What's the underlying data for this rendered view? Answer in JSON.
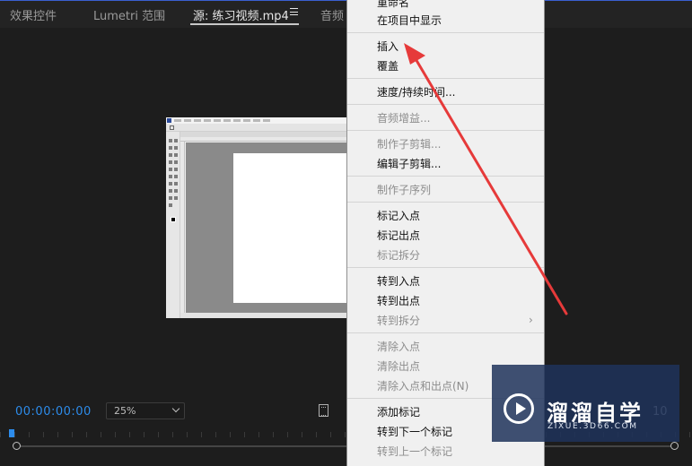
{
  "tabs": [
    {
      "label": "效果控件"
    },
    {
      "label": "Lumetri 范围"
    },
    {
      "label": "源: 练习视频.mp4"
    },
    {
      "label": "音频"
    }
  ],
  "player": {
    "timecode": "00:00:00:00",
    "zoom": "25%",
    "right_timecode": "10"
  },
  "menu": {
    "items": [
      {
        "label": "重命名",
        "enabled": true
      },
      {
        "label": "在项目中显示",
        "enabled": true
      },
      {
        "label": "插入",
        "enabled": true
      },
      {
        "label": "覆盖",
        "enabled": true
      },
      {
        "label": "速度/持续时间...",
        "enabled": true
      },
      {
        "label": "音频增益...",
        "enabled": false
      },
      {
        "label": "制作子剪辑...",
        "enabled": false
      },
      {
        "label": "编辑子剪辑...",
        "enabled": true
      },
      {
        "label": "制作子序列",
        "enabled": false
      },
      {
        "label": "标记入点",
        "enabled": true
      },
      {
        "label": "标记出点",
        "enabled": true
      },
      {
        "label": "标记拆分",
        "enabled": false
      },
      {
        "label": "转到入点",
        "enabled": true
      },
      {
        "label": "转到出点",
        "enabled": true
      },
      {
        "label": "转到拆分",
        "enabled": false
      },
      {
        "label": "清除入点",
        "enabled": false
      },
      {
        "label": "清除出点",
        "enabled": false
      },
      {
        "label": "清除入点和出点(N)",
        "enabled": false
      },
      {
        "label": "添加标记",
        "enabled": true
      },
      {
        "label": "转到下一个标记",
        "enabled": true
      },
      {
        "label": "转到上一个标记",
        "enabled": false
      }
    ],
    "submenu_arrow": "›"
  },
  "watermark": {
    "title": "溜溜自学",
    "subtitle": "ZIXUE.3D66.COM"
  },
  "colors": {
    "timecode": "#2d8ceb",
    "annotation": "#e63a3a",
    "accent_line": "#3a5fd0"
  }
}
